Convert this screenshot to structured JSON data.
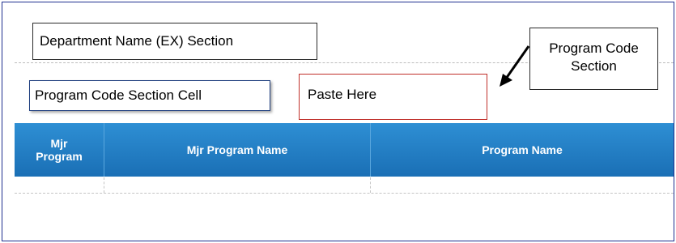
{
  "callouts": {
    "department_section": "Department Name (EX) Section",
    "program_code_section_cell": "Program Code Section Cell",
    "paste_here": "Paste Here",
    "program_code_section_line1": "Program Code",
    "program_code_section_line2": "Section"
  },
  "grid": {
    "columns": [
      {
        "line1": "Mjr",
        "line2": "Program"
      },
      {
        "line1": "Mjr Program Name"
      },
      {
        "line1": "Program Name"
      }
    ]
  },
  "colors": {
    "header_blue": "#1a6fb5",
    "frame_border": "#1f2f8f",
    "paste_border": "#c0302a"
  }
}
